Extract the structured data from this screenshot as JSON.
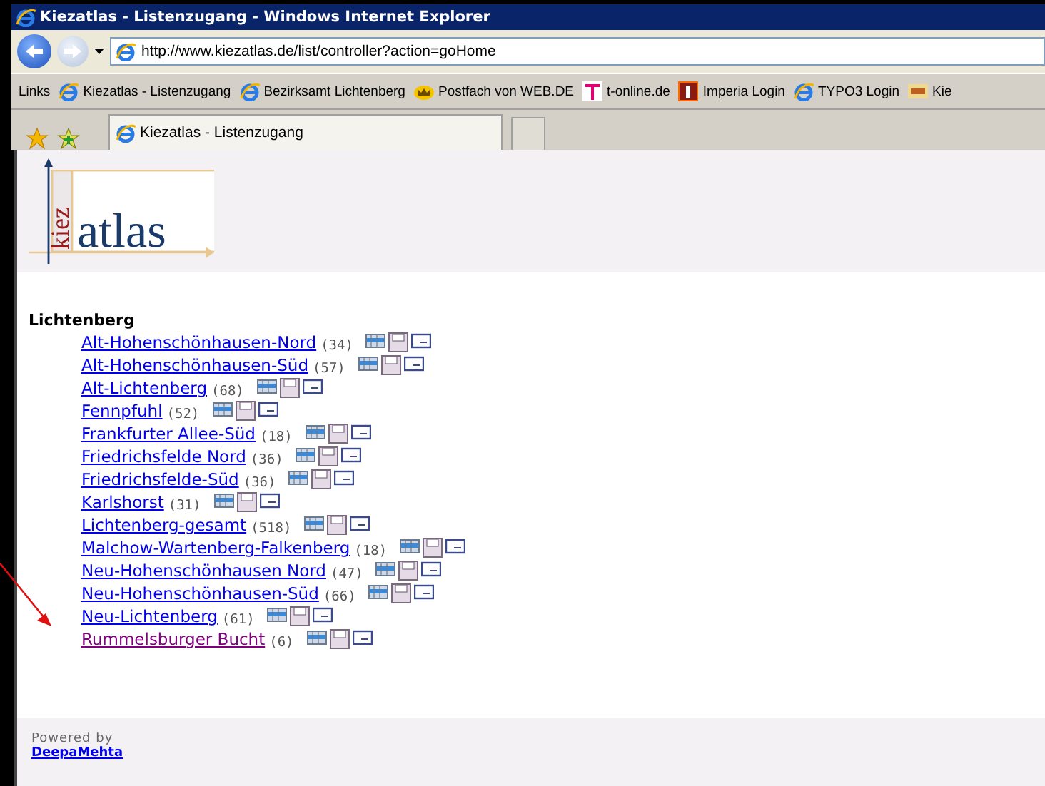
{
  "window": {
    "title": "Kiezatlas - Listenzugang - Windows Internet Explorer"
  },
  "address": {
    "url": "http://www.kiezatlas.de/list/controller?action=goHome"
  },
  "links_bar": {
    "label": "Links",
    "items": [
      {
        "label": "Kiezatlas - Listenzugang",
        "kind": "ie"
      },
      {
        "label": "Bezirksamt Lichtenberg",
        "kind": "ie"
      },
      {
        "label": "Postfach von WEB.DE",
        "kind": "webde"
      },
      {
        "label": "t-online.de",
        "kind": "tonline"
      },
      {
        "label": "Imperia Login",
        "kind": "imperia"
      },
      {
        "label": "TYPO3 Login",
        "kind": "ie"
      },
      {
        "label": "Kie",
        "kind": "kiez"
      }
    ]
  },
  "tabs": [
    {
      "label": "Kiezatlas - Listenzugang",
      "selected": true
    }
  ],
  "logo": {
    "vertical": "kiez",
    "main": "atlas"
  },
  "district": {
    "name": "Lichtenberg",
    "areas": [
      {
        "name": "Alt-Hohenschönhausen-Nord",
        "count": "(34)",
        "visited": false
      },
      {
        "name": "Alt-Hohenschönhausen-Süd",
        "count": "(57)",
        "visited": false
      },
      {
        "name": "Alt-Lichtenberg",
        "count": "(68)",
        "visited": false
      },
      {
        "name": "Fennpfuhl",
        "count": "(52)",
        "visited": false
      },
      {
        "name": "Frankfurter Allee-Süd",
        "count": "(18)",
        "visited": false
      },
      {
        "name": "Friedrichsfelde Nord",
        "count": "(36)",
        "visited": false
      },
      {
        "name": "Friedrichsfelde-Süd",
        "count": "(36)",
        "visited": false
      },
      {
        "name": "Karlshorst",
        "count": "(31)",
        "visited": false
      },
      {
        "name": "Lichtenberg-gesamt",
        "count": "(518)",
        "visited": false
      },
      {
        "name": "Malchow-Wartenberg-Falkenberg",
        "count": "(18)",
        "visited": false
      },
      {
        "name": "Neu-Hohenschönhausen Nord",
        "count": "(47)",
        "visited": false
      },
      {
        "name": "Neu-Hohenschönhausen-Süd",
        "count": "(66)",
        "visited": false
      },
      {
        "name": "Neu-Lichtenberg",
        "count": "(61)",
        "visited": false
      },
      {
        "name": "Rummelsburger Bucht",
        "count": "(6)",
        "visited": true
      }
    ]
  },
  "footer": {
    "powered_by": "Powered by",
    "link": "DeepaMehta"
  }
}
